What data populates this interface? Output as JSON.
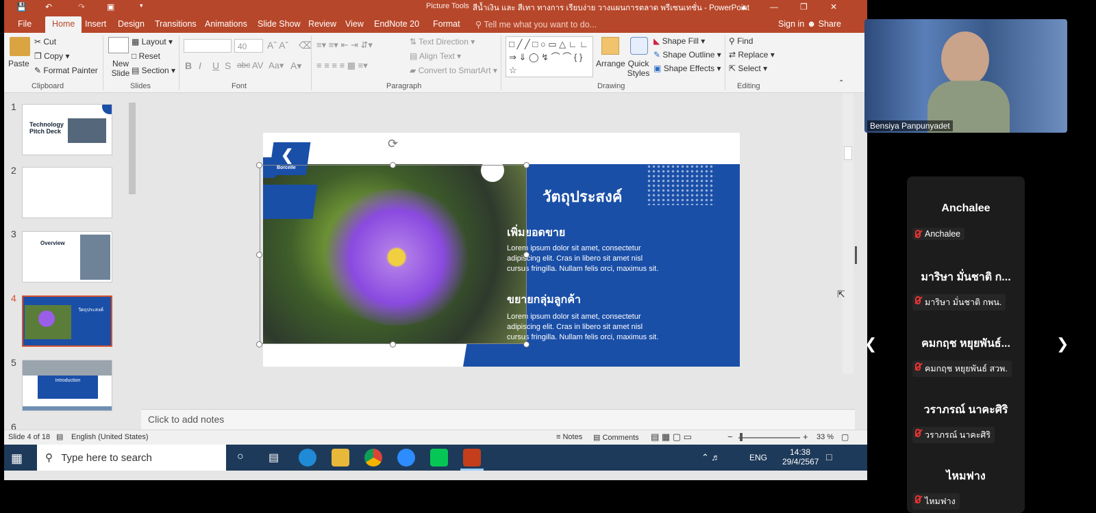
{
  "window": {
    "title": "สีน้ำเงิน และ สีเทา ทางการ เรียบง่าย วางแผนการตลาด พรีเซนเทชั่น - PowerPoint",
    "context_tab": "Picture Tools"
  },
  "tabs": [
    "File",
    "Home",
    "Insert",
    "Design",
    "Transitions",
    "Animations",
    "Slide Show",
    "Review",
    "View",
    "EndNote 20",
    "Format"
  ],
  "tell_me": "Tell me what you want to do...",
  "sign_in": "Sign in",
  "share": "Share",
  "ribbon": {
    "clipboard": {
      "paste": "Paste",
      "cut": "Cut",
      "copy": "Copy",
      "format_painter": "Format Painter",
      "label": "Clipboard"
    },
    "slides": {
      "new_slide": "New Slide",
      "layout": "Layout",
      "reset": "Reset",
      "section": "Section",
      "label": "Slides"
    },
    "font": {
      "size": "40",
      "label": "Font"
    },
    "paragraph": {
      "text_direction": "Text Direction",
      "align_text": "Align Text",
      "convert": "Convert to SmartArt",
      "label": "Paragraph"
    },
    "drawing": {
      "arrange": "Arrange",
      "quick_styles": "Quick Styles",
      "shape_fill": "Shape Fill",
      "shape_outline": "Shape Outline",
      "shape_effects": "Shape Effects",
      "label": "Drawing"
    },
    "editing": {
      "find": "Find",
      "replace": "Replace",
      "select": "Select",
      "label": "Editing"
    }
  },
  "thumbnails": [
    {
      "num": "1",
      "title": "Technology Pitch Deck"
    },
    {
      "num": "2",
      "title": ""
    },
    {
      "num": "3",
      "title": "Overview"
    },
    {
      "num": "4",
      "title": "วัตถุประสงค์"
    },
    {
      "num": "5",
      "title": "Introduction"
    },
    {
      "num": "6",
      "title": ""
    }
  ],
  "slide": {
    "logo_text": "Borcelle",
    "heading": "วัตถุประสงค์",
    "sub1": "เพิ่มยอดขาย",
    "body1": "Lorem ipsum dolor sit amet, consectetur adipiscing elit. Cras in libero sit amet nisl cursus fringilla. Nullam felis orci, maximus sit.",
    "sub2": "ขยายกลุ่มลูกค้า",
    "body2": "Lorem ipsum dolor sit amet, consectetur adipiscing elit. Cras in libero sit amet nisl cursus fringilla. Nullam felis orci, maximus sit."
  },
  "notes_placeholder": "Click to add notes",
  "status": {
    "slide": "Slide 4 of 18",
    "language": "English (United States)",
    "notes": "Notes",
    "comments": "Comments",
    "zoom": "33 %"
  },
  "taskbar": {
    "search": "Type here to search",
    "lang": "ENG",
    "time": "14:38",
    "date": "29/4/2567"
  },
  "meeting": {
    "speaker": "Bensiya Panpunyadet",
    "participants": [
      {
        "name": "Anchalee",
        "label": "Anchalee"
      },
      {
        "name": "มาริษา มั่นชาติ ก...",
        "label": "มาริษา มั่นชาติ กพน."
      },
      {
        "name": "คมกฤช หยุยพันธ์...",
        "label": "คมกฤช หยุยพันธ์ สวพ."
      },
      {
        "name": "วราภรณ์ นาคะศิริ",
        "label": "วราภรณ์ นาคะศิริ"
      },
      {
        "name": "ไหมฟาง",
        "label": "ไหมฟาง"
      }
    ]
  },
  "colors": {
    "accent": "#b7472a",
    "slide_blue": "#1a4fa8"
  }
}
